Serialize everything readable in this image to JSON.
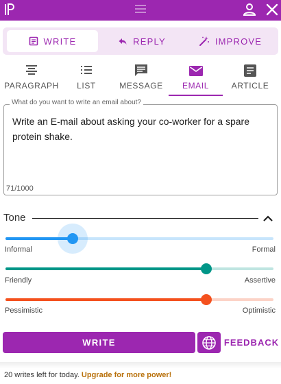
{
  "header": {
    "logo_icon": "p-logo-icon",
    "drag_icon": "drag-handle-icon",
    "user_icon": "account-icon",
    "close_icon": "close-icon",
    "accent_color": "#9c27b0"
  },
  "modes": [
    {
      "label": "WRITE",
      "icon": "document-icon",
      "selected": true
    },
    {
      "label": "REPLY",
      "icon": "reply-icon",
      "selected": false
    },
    {
      "label": "IMPROVE",
      "icon": "magic-wand-icon",
      "selected": false
    }
  ],
  "types": [
    {
      "label": "PARAGRAPH",
      "icon": "align-center-icon",
      "selected": false
    },
    {
      "label": "LIST",
      "icon": "list-icon",
      "selected": false
    },
    {
      "label": "MESSAGE",
      "icon": "message-icon",
      "selected": false
    },
    {
      "label": "EMAIL",
      "icon": "email-icon",
      "selected": true
    },
    {
      "label": "ARTICLE",
      "icon": "article-icon",
      "selected": false
    }
  ],
  "prompt": {
    "label": "What do you want to write an email about?",
    "value": "Write an E-mail about asking your co-worker for a spare protein shake.",
    "counter": "71/1000"
  },
  "tone": {
    "title": "Tone",
    "expanded": true,
    "sliders": [
      {
        "left": "Informal",
        "right": "Formal",
        "value": 0.25,
        "color": "#2196f3"
      },
      {
        "left": "Friendly",
        "right": "Assertive",
        "value": 0.75,
        "color": "#009688"
      },
      {
        "left": "Pessimistic",
        "right": "Optimistic",
        "value": 0.75,
        "color": "#f4511e"
      }
    ]
  },
  "actions": {
    "write_label": "WRITE",
    "language_icon": "globe-icon",
    "feedback_label": "FEEDBACK"
  },
  "footer": {
    "text": "20 writes left for today.",
    "link": "Upgrade for more power!"
  }
}
